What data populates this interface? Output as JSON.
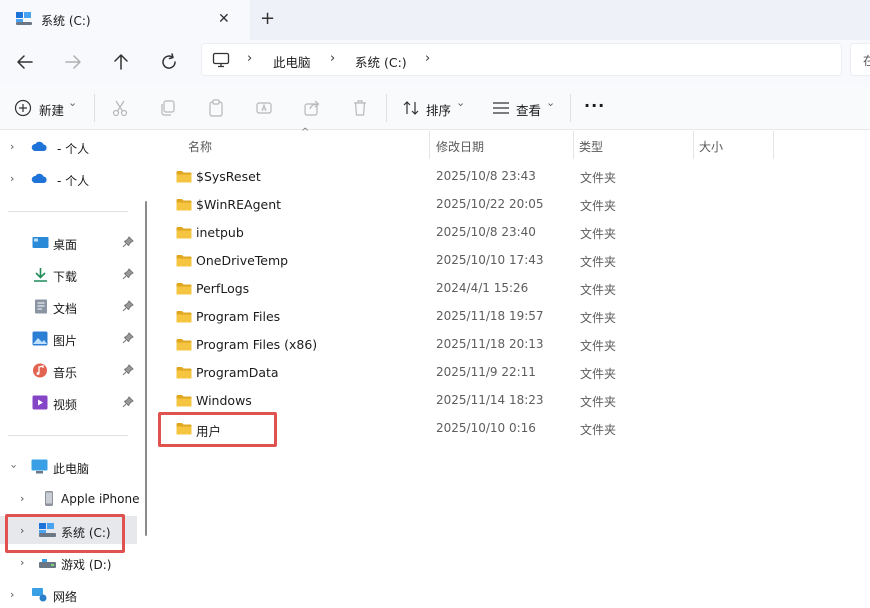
{
  "tab": {
    "title": "系统 (C:)",
    "close": "✕",
    "new_tab": "+"
  },
  "address": {
    "crumbs": [
      "此电脑",
      "系统 (C:)"
    ],
    "separator": "›",
    "search_glyph": "在"
  },
  "commands": {
    "new_label": "新建",
    "sort_label": "排序",
    "view_label": "查看",
    "more_label": "···",
    "dropdown_caret": "⌄"
  },
  "sidebar": {
    "onedrive": [
      {
        "label": "- 个人",
        "icon": "onedrive-cloud-icon"
      },
      {
        "label": "- 个人",
        "icon": "onedrive-cloud-icon"
      }
    ],
    "quick_access": [
      {
        "label": "桌面",
        "icon": "desktop-icon"
      },
      {
        "label": "下载",
        "icon": "download-icon"
      },
      {
        "label": "文档",
        "icon": "document-icon"
      },
      {
        "label": "图片",
        "icon": "pictures-icon"
      },
      {
        "label": "音乐",
        "icon": "music-icon"
      },
      {
        "label": "视频",
        "icon": "video-icon"
      }
    ],
    "this_pc": {
      "label": "此电脑",
      "icon": "monitor-icon"
    },
    "devices": [
      {
        "label": "Apple iPhone",
        "icon": "phone-icon"
      },
      {
        "label": "系统 (C:)",
        "icon": "drive-c-icon",
        "selected": true
      },
      {
        "label": "游戏 (D:)",
        "icon": "drive-d-icon"
      },
      {
        "label": "网络",
        "icon": "network-icon"
      }
    ]
  },
  "columns": {
    "name": "名称",
    "date": "修改日期",
    "type": "类型",
    "size": "大小"
  },
  "files": [
    {
      "name": "$SysReset",
      "date": "2025/10/8 23:43",
      "type": "文件夹"
    },
    {
      "name": "$WinREAgent",
      "date": "2025/10/22 20:05",
      "type": "文件夹"
    },
    {
      "name": "inetpub",
      "date": "2025/10/8 23:40",
      "type": "文件夹"
    },
    {
      "name": "OneDriveTemp",
      "date": "2025/10/10 17:43",
      "type": "文件夹"
    },
    {
      "name": "PerfLogs",
      "date": "2024/4/1 15:26",
      "type": "文件夹"
    },
    {
      "name": "Program Files",
      "date": "2025/11/18 19:57",
      "type": "文件夹"
    },
    {
      "name": "Program Files (x86)",
      "date": "2025/11/18 20:13",
      "type": "文件夹"
    },
    {
      "name": "ProgramData",
      "date": "2025/11/9 22:11",
      "type": "文件夹"
    },
    {
      "name": "Windows",
      "date": "2025/11/14 18:23",
      "type": "文件夹"
    },
    {
      "name": "用户",
      "date": "2025/10/10 0:16",
      "type": "文件夹"
    }
  ],
  "colors": {
    "folder_yellow": "#f5c542",
    "folder_dark": "#e0a820",
    "highlight_red": "#e05250",
    "onedrive_blue": "#1e73d8",
    "selected_bg": "#e6e8ec"
  }
}
